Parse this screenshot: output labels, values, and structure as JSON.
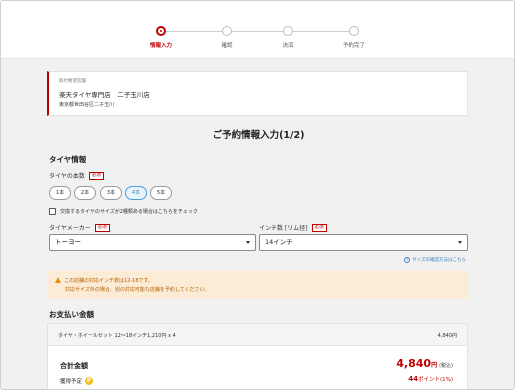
{
  "stepper": {
    "steps": [
      {
        "label": "情報入力",
        "active": true
      },
      {
        "label": "確認",
        "active": false
      },
      {
        "label": "決済",
        "active": false
      },
      {
        "label": "予約完了",
        "active": false
      }
    ]
  },
  "store": {
    "caption": "取付希望店舗",
    "name": "楽天タイヤ専門店　二子玉川店",
    "address": "東京都世田谷区二子玉川"
  },
  "page_title": "ご予約情報入力(1/2)",
  "tire_info": {
    "section_title": "タイヤ情報",
    "count_label": "タイヤの本数",
    "required_badge": "必須",
    "count_options": [
      "1本",
      "2本",
      "3本",
      "4本",
      "5本"
    ],
    "selected_count": "4本",
    "mixed_size_label": "交換するタイヤのサイズが2種類ある場合はこちらをチェック",
    "maker_label": "タイヤメーカー",
    "maker_value": "トーヨー",
    "inch_label": "インチ数 [リム径]",
    "inch_value": "14インチ",
    "size_help_link": "サイズの確認方法はこちら"
  },
  "notice": {
    "line1": "この店舗の対応インチ数は12-18です。",
    "line2": "対応サイズ外の場合、別の対応可能な店舗を予約してください。"
  },
  "payment": {
    "section_title": "お支払い金額",
    "item_label": "タイヤ・ホイールセット 12〜18インチ1,210円 x 4",
    "item_price": "4,840円",
    "total_label": "合計金額",
    "total_value": "4,840",
    "total_unit": "円",
    "tax_note": "(税込)",
    "points_label": "獲得予定",
    "points_icon": "P",
    "points_value": "44",
    "points_unit": "ポイント(1%)"
  },
  "colors": {
    "accent": "#bf0000",
    "selected": "#3a8ec8",
    "notice_bg": "#fdecd5"
  }
}
